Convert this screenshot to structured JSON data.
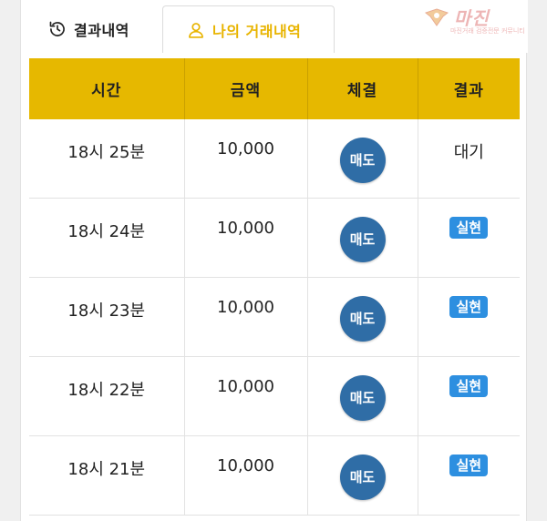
{
  "tabs": {
    "results_label": "결과내역",
    "my_trades_label": "나의 거래내역",
    "active_color": "#e8b400"
  },
  "watermark": {
    "text": "마진 ",
    "subtext": "마진거래 검증전문 커뮤니티"
  },
  "table": {
    "columns": [
      "시간",
      "금액",
      "체결",
      "결과"
    ],
    "rows": [
      {
        "time": "18시 25분",
        "amount": "10,000",
        "execution": "매도",
        "result": "대기",
        "result_type": "pending"
      },
      {
        "time": "18시 24분",
        "amount": "10,000",
        "execution": "매도",
        "result": "실현",
        "result_type": "realized"
      },
      {
        "time": "18시 23분",
        "amount": "10,000",
        "execution": "매도",
        "result": "실현",
        "result_type": "realized"
      },
      {
        "time": "18시 22분",
        "amount": "10,000",
        "execution": "매도",
        "result": "실현",
        "result_type": "realized"
      },
      {
        "time": "18시 21분",
        "amount": "10,000",
        "execution": "매도",
        "result": "실현",
        "result_type": "realized"
      }
    ]
  },
  "colors": {
    "header_bg": "#e6b800",
    "sell_badge": "#2f6da6",
    "realized_badge": "#2d8fe0"
  }
}
